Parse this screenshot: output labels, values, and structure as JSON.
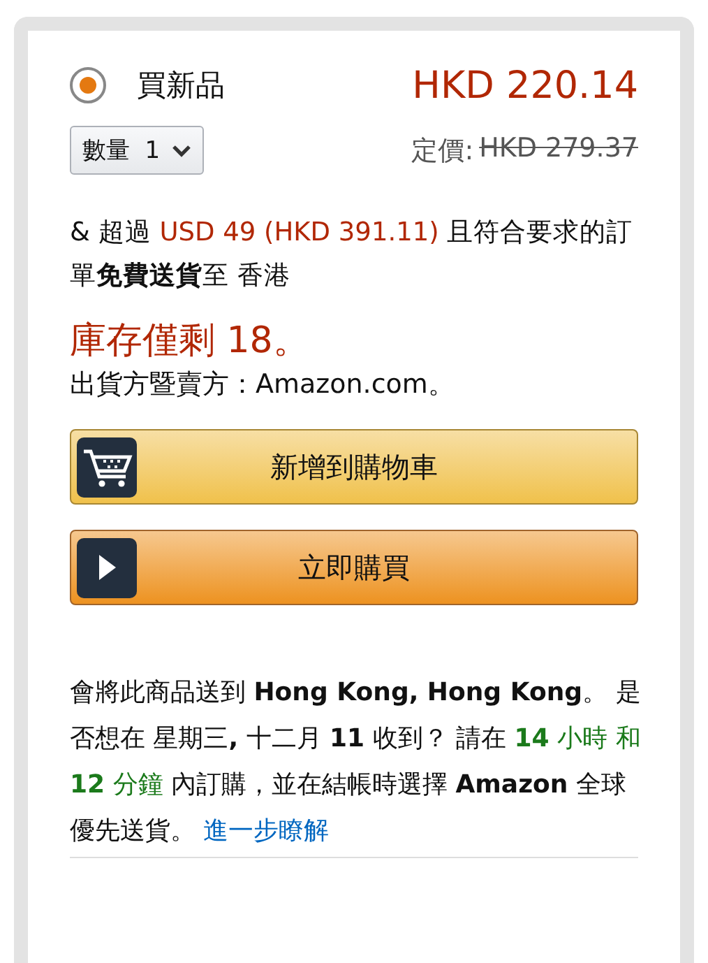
{
  "offer": {
    "label": "買新品",
    "selected": true,
    "price": "HKD 220.14"
  },
  "quantity": {
    "label": "數量",
    "value": "1"
  },
  "list_price": {
    "label": "定價:",
    "value": "HKD 279.37"
  },
  "free_shipping": [
    {
      "kind": "plain",
      "text": "& 超過 "
    },
    {
      "kind": "price",
      "text": "USD 49 (HKD 391.11)"
    },
    {
      "kind": "plain",
      "text": " 且符合要求的訂單**免費送貨**至 香港"
    }
  ],
  "stock": "庫存僅剩 18。",
  "seller": "出貨方暨賣方：Amazon.com。",
  "buttons": [
    {
      "kind": "cart",
      "label": "新增到購物車"
    },
    {
      "kind": "buy",
      "label": "立即購買"
    }
  ],
  "delivery": [
    {
      "kind": "plain",
      "text": "會將此商品送到 **Hong Kong, Hong Kong**。 是否想在 星期三**,** 十二月 **11** 收到？ 請在 "
    },
    {
      "kind": "countdown",
      "text": "**14** 小時 和 **12** 分鐘"
    },
    {
      "kind": "plain",
      "text": " 內訂購，並在結帳時選擇 **Amazon** 全球優先送貨。 "
    },
    {
      "kind": "link",
      "text": "進一步瞭解"
    }
  ]
}
